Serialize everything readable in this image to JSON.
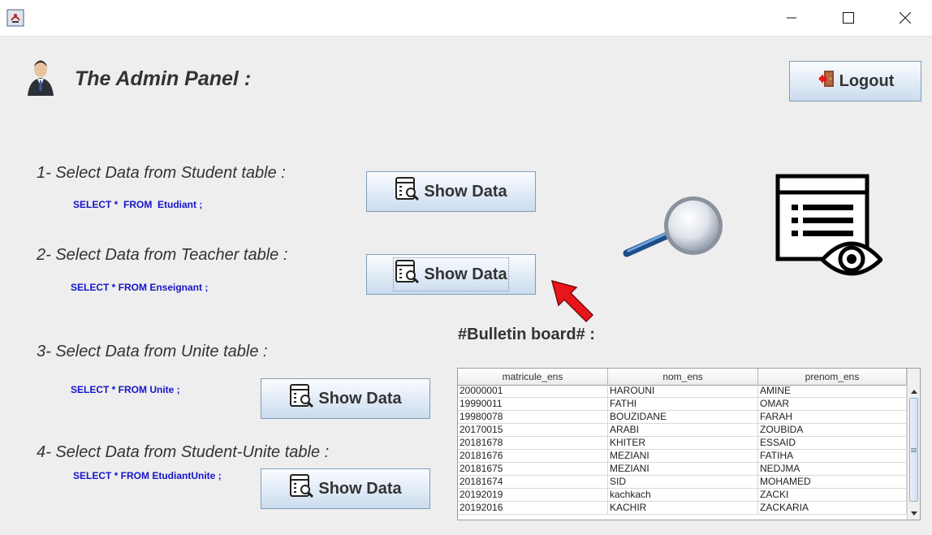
{
  "header": {
    "title": "The Admin Panel  :",
    "logout_label": "Logout"
  },
  "sections": [
    {
      "label": "1- Select Data from Student table :",
      "sql": "SELECT *  FROM  Etudiant ;",
      "button_label": "Show Data"
    },
    {
      "label": "2- Select Data from Teacher table :",
      "sql": "SELECT * FROM Enseignant ;",
      "button_label": "Show Data"
    },
    {
      "label": "3- Select Data from Unite table :",
      "sql": "SELECT * FROM Unite ;",
      "button_label": "Show Data"
    },
    {
      "label": "4- Select Data from Student-Unite table :",
      "sql": "SELECT * FROM EtudiantUnite ;",
      "button_label": "Show Data"
    }
  ],
  "bulletin": {
    "title": "#Bulletin board# :",
    "columns": [
      "matricule_ens",
      "nom_ens",
      "prenom_ens"
    ],
    "rows": [
      [
        "20000001",
        "HAROUNI",
        "AMINE"
      ],
      [
        "19990011",
        "FATHI",
        "OMAR"
      ],
      [
        "19980078",
        "BOUZIDANE",
        "FARAH"
      ],
      [
        "20170015",
        "ARABI",
        "ZOUBIDA"
      ],
      [
        "20181678",
        "KHITER",
        "ESSAID"
      ],
      [
        "20181676",
        "MEZIANI",
        "FATIHA"
      ],
      [
        "20181675",
        "MEZIANI",
        "NEDJMA"
      ],
      [
        "20181674",
        "SID",
        "MOHAMED"
      ],
      [
        "20192019",
        "kachkach",
        "ZACKI"
      ],
      [
        "20192016",
        "KACHIR",
        "ZACKARIA"
      ]
    ]
  },
  "icons": {
    "window": "java-app-icon",
    "admin": "admin-user-icon",
    "logout": "logout-door-icon",
    "show_data": "table-search-icon",
    "search": "magnifier-icon",
    "view": "document-eye-icon",
    "annotation": "red-arrow-icon"
  },
  "colors": {
    "sql_text": "#1515c8",
    "button_gradient_top": "#fbfcfe",
    "button_gradient_bottom": "#cbdcee",
    "arrow": "#e8161b"
  }
}
